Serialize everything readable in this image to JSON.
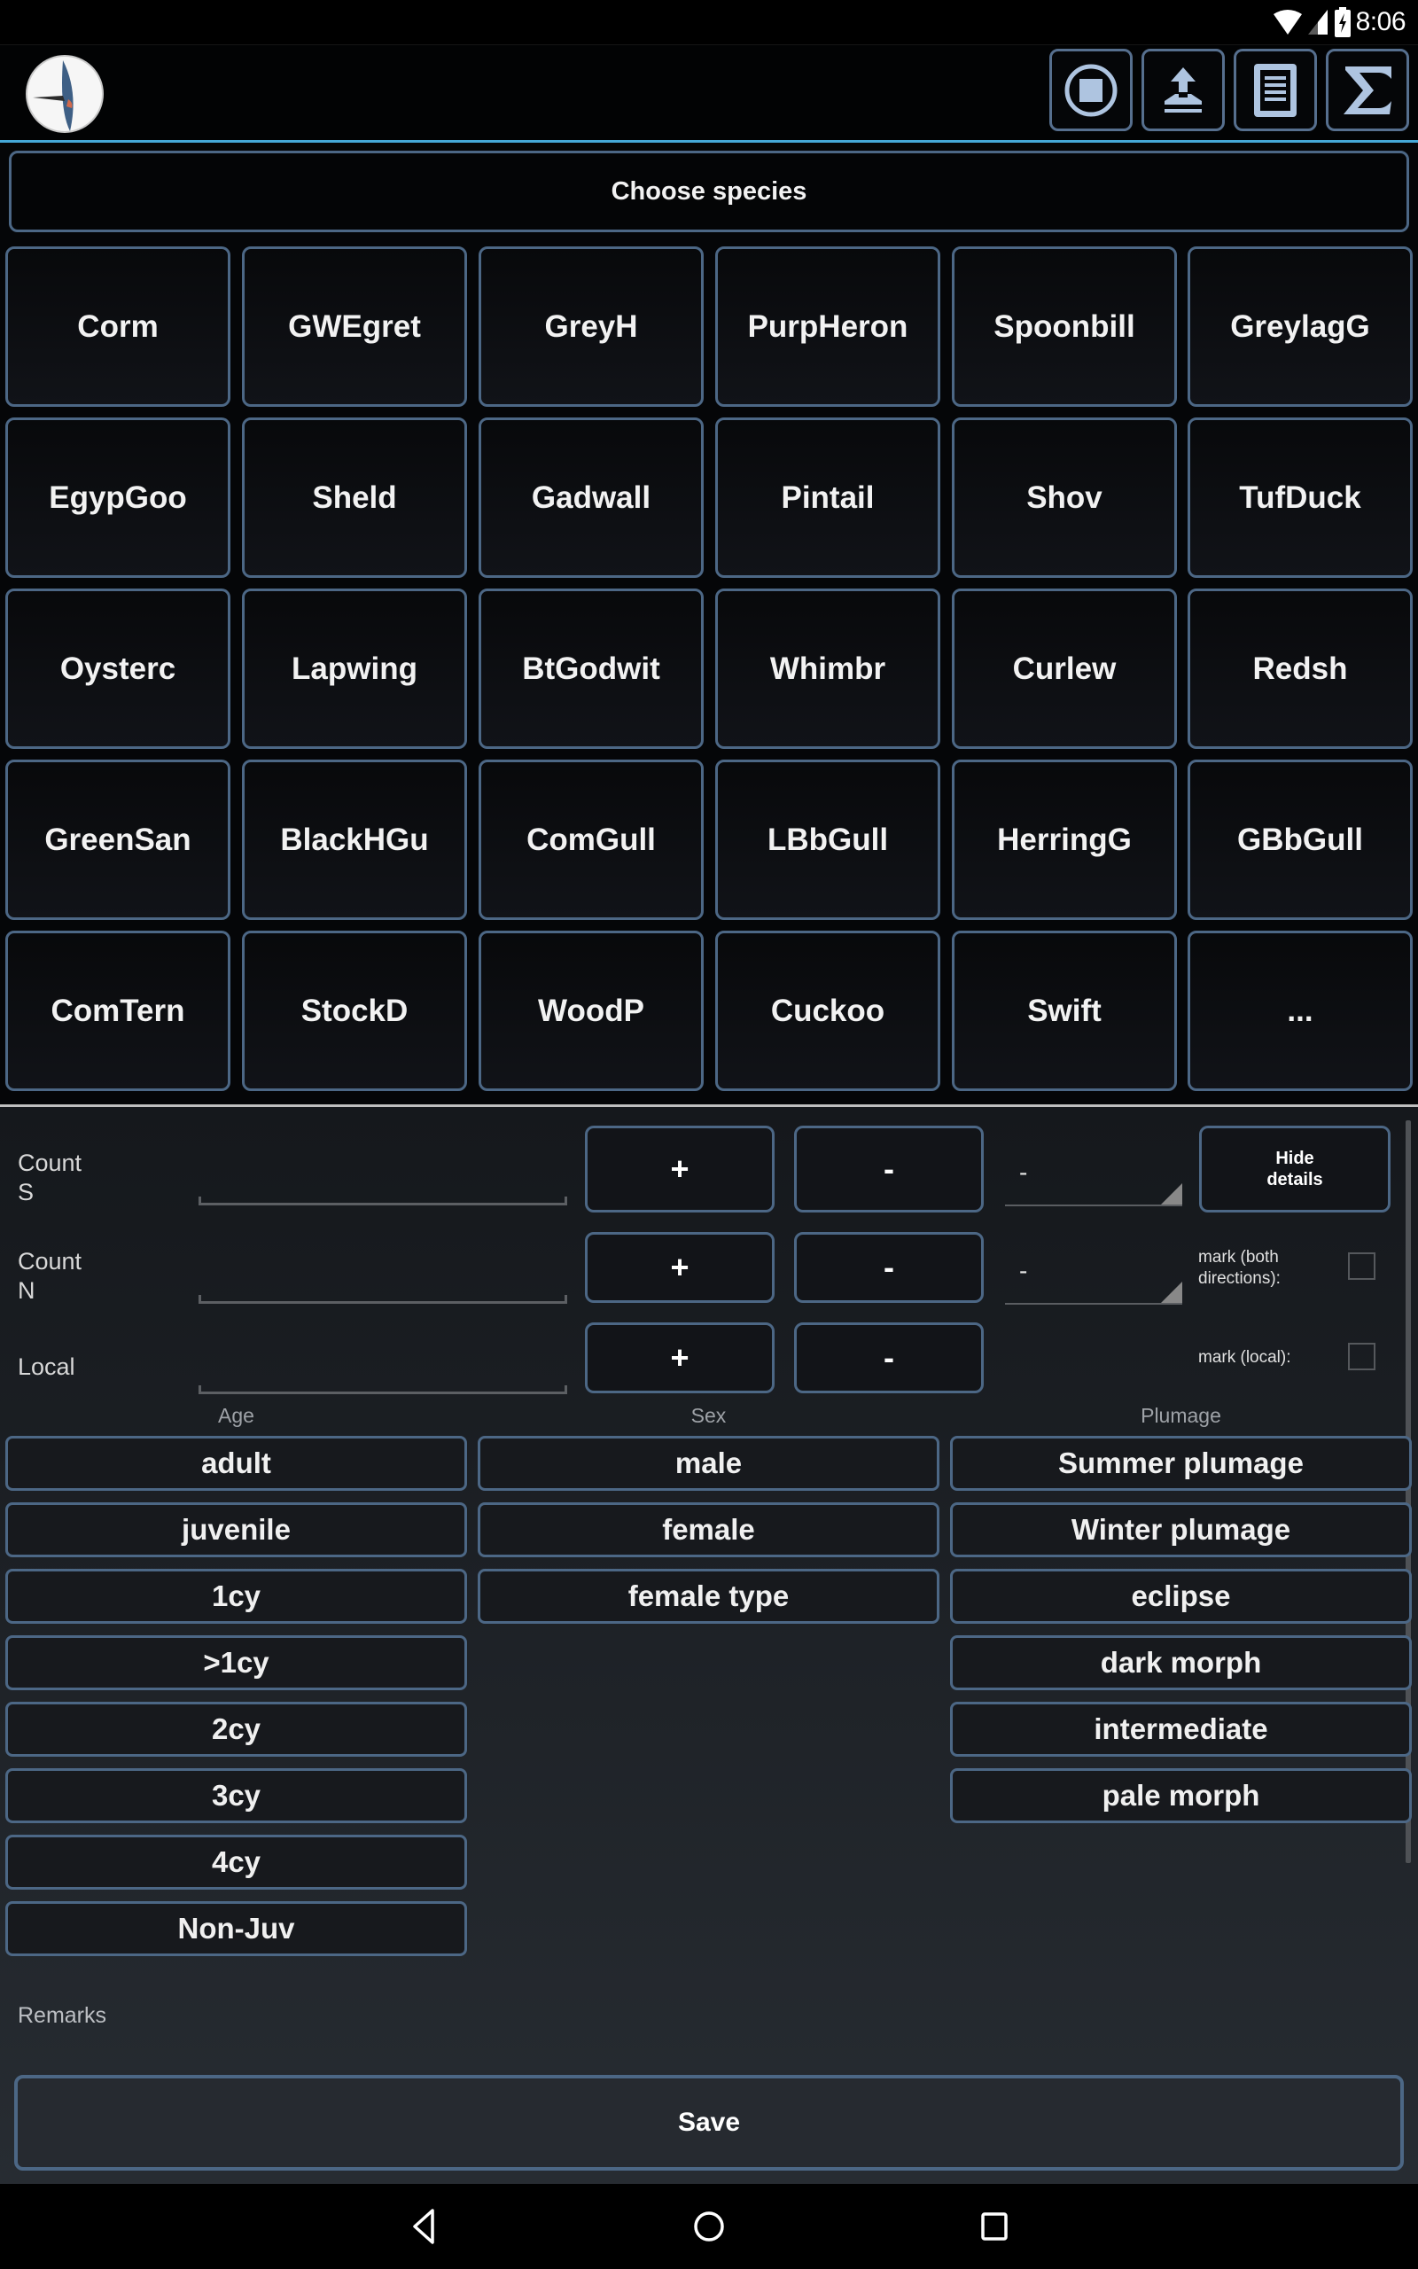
{
  "status_bar": {
    "time": "8:06",
    "icons": [
      "wifi-icon",
      "cell-signal-icon",
      "battery-charging-icon"
    ]
  },
  "toolbar": {
    "logo": "swallow-logo",
    "buttons": [
      {
        "name": "stop-button",
        "icon": "stop-circle-icon"
      },
      {
        "name": "upload-button",
        "icon": "upload-tray-icon"
      },
      {
        "name": "list-button",
        "icon": "document-list-icon"
      },
      {
        "name": "sum-button",
        "icon": "sigma-icon"
      }
    ]
  },
  "choose_species_label": "Choose species",
  "species": [
    [
      "Corm",
      "GWEgret",
      "GreyH",
      "PurpHeron",
      "Spoonbill",
      "GreylagG"
    ],
    [
      "EgypGoo",
      "Sheld",
      "Gadwall",
      "Pintail",
      "Shov",
      "TufDuck"
    ],
    [
      "Oysterc",
      "Lapwing",
      "BtGodwit",
      "Whimbr",
      "Curlew",
      "Redsh"
    ],
    [
      "GreenSan",
      "BlackHGu",
      "ComGull",
      "LBbGull",
      "HerringG",
      "GBbGull"
    ],
    [
      "ComTern",
      "StockD",
      "WoodP",
      "Cuckoo",
      "Swift",
      "..."
    ]
  ],
  "counts": {
    "count_s": {
      "label_line1": "Count",
      "label_line2": "S",
      "value": "",
      "plus": "+",
      "minus": "-",
      "direction": "-"
    },
    "count_n": {
      "label_line1": "Count",
      "label_line2": "N",
      "value": "",
      "plus": "+",
      "minus": "-",
      "direction": "-"
    },
    "local": {
      "label": "Local",
      "value": "",
      "plus": "+",
      "minus": "-"
    }
  },
  "hide_details": {
    "line1": "Hide",
    "line2": "details"
  },
  "marks": {
    "both": {
      "line1": "mark (both",
      "line2": "directions):",
      "checked": false
    },
    "local": {
      "label": "mark (local):",
      "checked": false
    }
  },
  "attributes": {
    "age": {
      "label": "Age",
      "options": [
        "adult",
        "juvenile",
        "1cy",
        ">1cy",
        "2cy",
        "3cy",
        "4cy",
        "Non-Juv"
      ]
    },
    "sex": {
      "label": "Sex",
      "options": [
        "male",
        "female",
        "female type"
      ]
    },
    "plumage": {
      "label": "Plumage",
      "options": [
        "Summer plumage",
        "Winter plumage",
        "eclipse",
        "dark morph",
        "intermediate",
        "pale morph"
      ]
    }
  },
  "remarks_label": "Remarks",
  "save_label": "Save",
  "nav": [
    "back-icon",
    "home-icon",
    "recents-icon"
  ]
}
